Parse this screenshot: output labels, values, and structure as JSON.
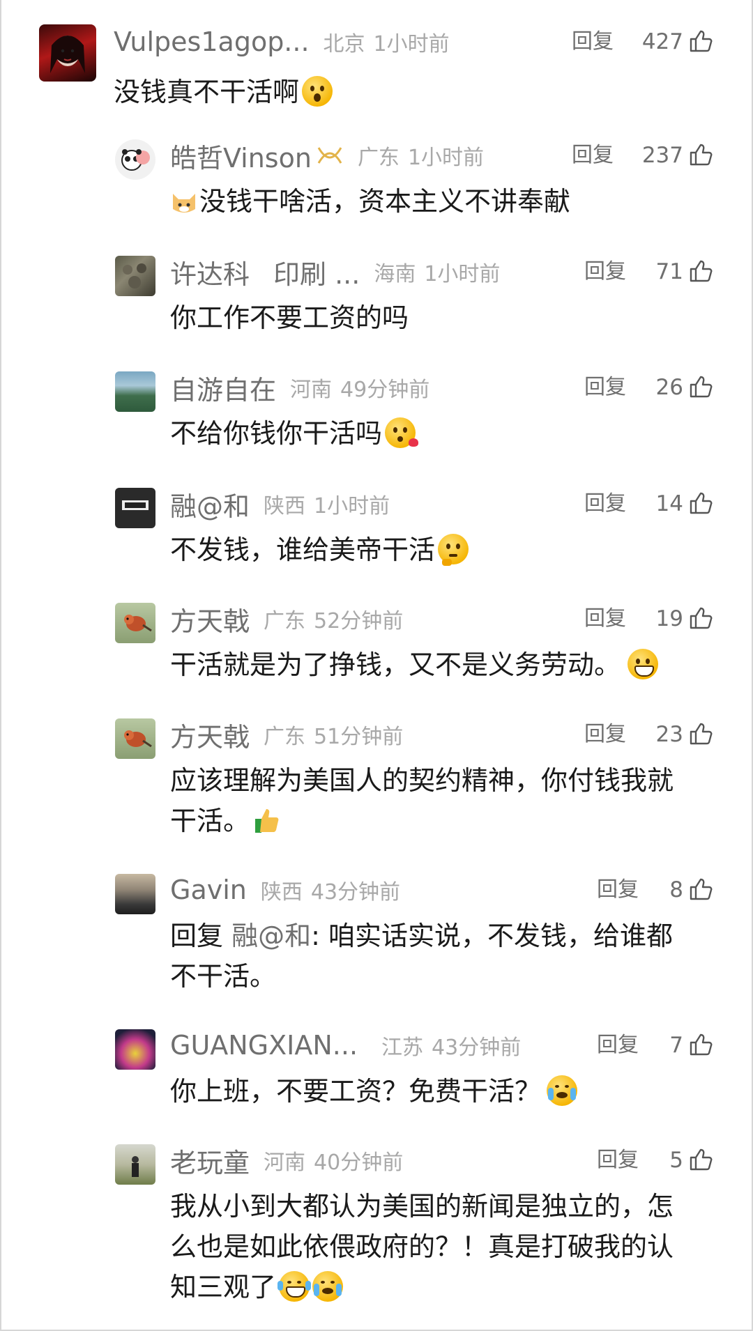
{
  "reply_label": "回复",
  "comments": [
    {
      "username": "Vulpes1agop...",
      "location": "北京",
      "time": "1小时前",
      "likes": "427",
      "text": "没钱真不干活啊",
      "emoji": "hushed-face-emoji"
    },
    {
      "username": "皓哲Vinson",
      "badge": "gold-ribbon-badge-icon",
      "location": "广东",
      "time": "1小时前",
      "likes": "237",
      "text": "没钱干啥活，资本主义不讲奉献",
      "lead_emoji": "cat-face-emoji"
    },
    {
      "username": "许达科",
      "username_suffix": "印刷 ...",
      "location": "海南",
      "time": "1小时前",
      "likes": "71",
      "text": "你工作不要工资的吗"
    },
    {
      "username": "自游自在",
      "location": "河南",
      "time": "49分钟前",
      "likes": "26",
      "text": "不给你钱你干活吗",
      "emoji": "face-blowing-kiss-emoji"
    },
    {
      "username": "融@和",
      "location": "陕西",
      "time": "1小时前",
      "likes": "14",
      "text": "不发钱，谁给美帝干活",
      "emoji": "thinking-face-emoji"
    },
    {
      "username": "方天戟",
      "location": "广东",
      "time": "52分钟前",
      "likes": "19",
      "text": "干活就是为了挣钱，又不是义务劳动。",
      "emoji": "grinning-face-emoji"
    },
    {
      "username": "方天戟",
      "location": "广东",
      "time": "51分钟前",
      "likes": "23",
      "text_line1": "应该理解为美国人的契约精神，你付钱我就",
      "text_line2": "干活。",
      "emoji": "thumbs-up-emoji"
    },
    {
      "username": "Gavin",
      "location": "陕西",
      "time": "43分钟前",
      "likes": "8",
      "reply_prefix": "回复",
      "reply_target": "融@和",
      "text_line1": ": 咱实话实说，不发钱，给谁都",
      "text_line2": "不干活。"
    },
    {
      "username": "GUANGXIAN...",
      "location": "江苏",
      "time": "43分钟前",
      "likes": "7",
      "text": "你上班，不要工资？免费干活？",
      "emoji": "crying-face-emoji"
    },
    {
      "username": "老玩童",
      "location": "河南",
      "time": "40分钟前",
      "likes": "5",
      "text_line1": "我从小到大都认为美国的新闻是独立的，怎",
      "text_line2": "么也是如此依偎政府的？！真是打破我的认",
      "text_line3": "知三观了",
      "emoji": "tears-of-joy-emoji",
      "emoji2": "crying-face-emoji"
    }
  ]
}
